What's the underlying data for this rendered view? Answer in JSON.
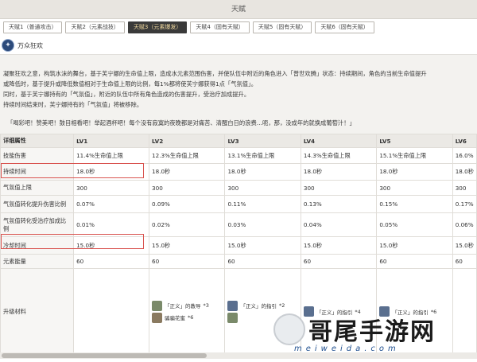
{
  "window": {
    "title": "天赋"
  },
  "tabs": [
    {
      "label": "天赋1（普通攻击）",
      "active": false
    },
    {
      "label": "天赋2（元素战技）",
      "active": false
    },
    {
      "label": "天赋3（元素爆发）",
      "active": true
    },
    {
      "label": "天赋4（固有天赋）",
      "active": false
    },
    {
      "label": "天赋5（固有天赋）",
      "active": false
    },
    {
      "label": "天赋6（固有天赋）",
      "active": false
    }
  ],
  "skill": {
    "name": "万众狂欢",
    "icon": "burst-icon",
    "description": [
      "凝聚狂欢之意，构筑水沫的舞台，基于芙宁娜的生命值上限，造成水元素范围伤害，并使队伍中附近的角色进入「普世欢腾」状态：持续期间，角色的当前生命值提升",
      "或降低时，基于提升或降低数值相对于生命值上限的比例，每1%都将使芙宁娜获得1点「气氛值」。",
      "同时，基于芙宁娜持有的「气氛值」，附近的队伍中所有角色造成的伤害提升，受治疗加成提升。",
      "持续时间结束时，芙宁娜持有的「气氛值」将被移除。"
    ],
    "quote": "「喝彩吧！赞美吧！鼓目相看吧！举起酒杯吧！每个没有寂寞的夜晚都是对痛苦、清醒白日的浪费…呃，那，没成年的就换成葡萄汁！」"
  },
  "table": {
    "headers": [
      "详细属性",
      "LV1",
      "LV2",
      "LV3",
      "LV4",
      "LV5",
      "LV6"
    ],
    "rows": [
      {
        "label": "技能伤害",
        "values": [
          "11.4%生命值上限",
          "12.3%生命值上限",
          "13.1%生命值上限",
          "14.3%生命值上限",
          "15.1%生命值上限",
          "16.0%"
        ]
      },
      {
        "label": "持续时间",
        "values": [
          "18.0秒",
          "18.0秒",
          "18.0秒",
          "18.0秒",
          "18.0秒",
          "18.0秒"
        ]
      },
      {
        "label": "气氛值上限",
        "values": [
          "300",
          "300",
          "300",
          "300",
          "300",
          "300"
        ]
      },
      {
        "label": "气氛值转化提升伤害比例",
        "values": [
          "0.07%",
          "0.09%",
          "0.11%",
          "0.13%",
          "0.15%",
          "0.17%"
        ]
      },
      {
        "label": "气氛值转化受治疗加成比例",
        "values": [
          "0.01%",
          "0.02%",
          "0.03%",
          "0.04%",
          "0.05%",
          "0.06%"
        ]
      },
      {
        "label": "冷却时间",
        "values": [
          "15.0秒",
          "15.0秒",
          "15.0秒",
          "15.0秒",
          "15.0秒",
          "15.0秒"
        ]
      },
      {
        "label": "元素能量",
        "values": [
          "60",
          "60",
          "60",
          "60",
          "60",
          "60"
        ]
      }
    ],
    "materials_label": "升级材料",
    "materials": {
      "lv2": [
        {
          "name": "「正义」的教导",
          "count": "*3"
        },
        {
          "name": "骗骗花蜜",
          "count": "*6"
        }
      ],
      "lv3": [
        {
          "name": "「正义」的指引",
          "count": "*2"
        },
        {
          "name": "",
          "count": ""
        }
      ],
      "lv4": [
        {
          "name": "「正义」的指引",
          "count": "*4"
        }
      ],
      "lv5": [
        {
          "name": "「正义」的指引",
          "count": "*6"
        }
      ]
    }
  },
  "watermark": {
    "text": "哥尾手游网",
    "url": "meiweida.com"
  }
}
